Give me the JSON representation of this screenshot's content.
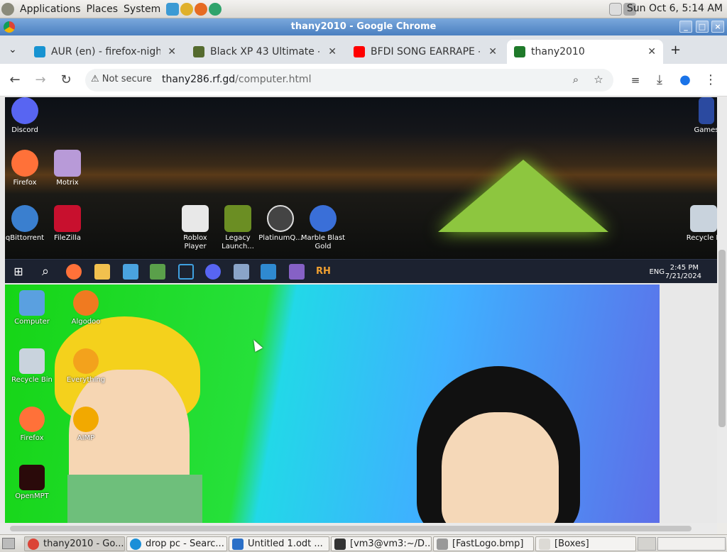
{
  "gnome_panel": {
    "menus": [
      "Applications",
      "Places",
      "System"
    ],
    "clock": "Sun Oct  6,  5:14 AM"
  },
  "window": {
    "title": "thany2010 - Google Chrome"
  },
  "tabs": [
    {
      "title": "AUR (en) - firefox-nightly",
      "icon": "arch-icon",
      "color": "#1793d1"
    },
    {
      "title": "Black XP 43 Ultimate - Cru",
      "icon": "xp-icon",
      "color": "#556b2f"
    },
    {
      "title": "BFDI SONG EARRAPE - Yo",
      "icon": "youtube-icon",
      "color": "#ff0000"
    },
    {
      "title": "thany2010",
      "icon": "site-icon",
      "color": "#1f7a2a",
      "active": true
    }
  ],
  "toolbar": {
    "security": "Not secure",
    "url_host": "thany286.rf.gd",
    "url_path": "/computer.html"
  },
  "shot1": {
    "icons_left": [
      {
        "label": "Discord"
      },
      {
        "label": "Firefox"
      },
      {
        "label": "Motrix"
      },
      {
        "label": "qBittorrent"
      },
      {
        "label": "FileZilla"
      }
    ],
    "icons_mid": [
      {
        "label": "Roblox Player"
      },
      {
        "label": "Legacy Launch..."
      },
      {
        "label": "PlatinumQ..."
      },
      {
        "label": "Marble Blast Gold"
      }
    ],
    "icons_right": [
      {
        "label": "Games"
      },
      {
        "label": "Recycle B"
      }
    ],
    "tray": {
      "lang": "ENG",
      "time": "2:45 PM",
      "date": "7/21/2024"
    }
  },
  "shot2": {
    "icons": [
      {
        "label": "Computer"
      },
      {
        "label": "Algodoo"
      },
      {
        "label": "Recycle Bin"
      },
      {
        "label": "Everything"
      },
      {
        "label": "Firefox"
      },
      {
        "label": "AIMP"
      },
      {
        "label": "OpenMPT"
      }
    ]
  },
  "taskbar": [
    {
      "label": "thany2010 - Go...",
      "active": true
    },
    {
      "label": "drop pc - Searc..."
    },
    {
      "label": "Untitled 1.odt ..."
    },
    {
      "label": "[vm3@vm3:~/D..."
    },
    {
      "label": "[FastLogo.bmp]"
    },
    {
      "label": "[Boxes]"
    }
  ]
}
